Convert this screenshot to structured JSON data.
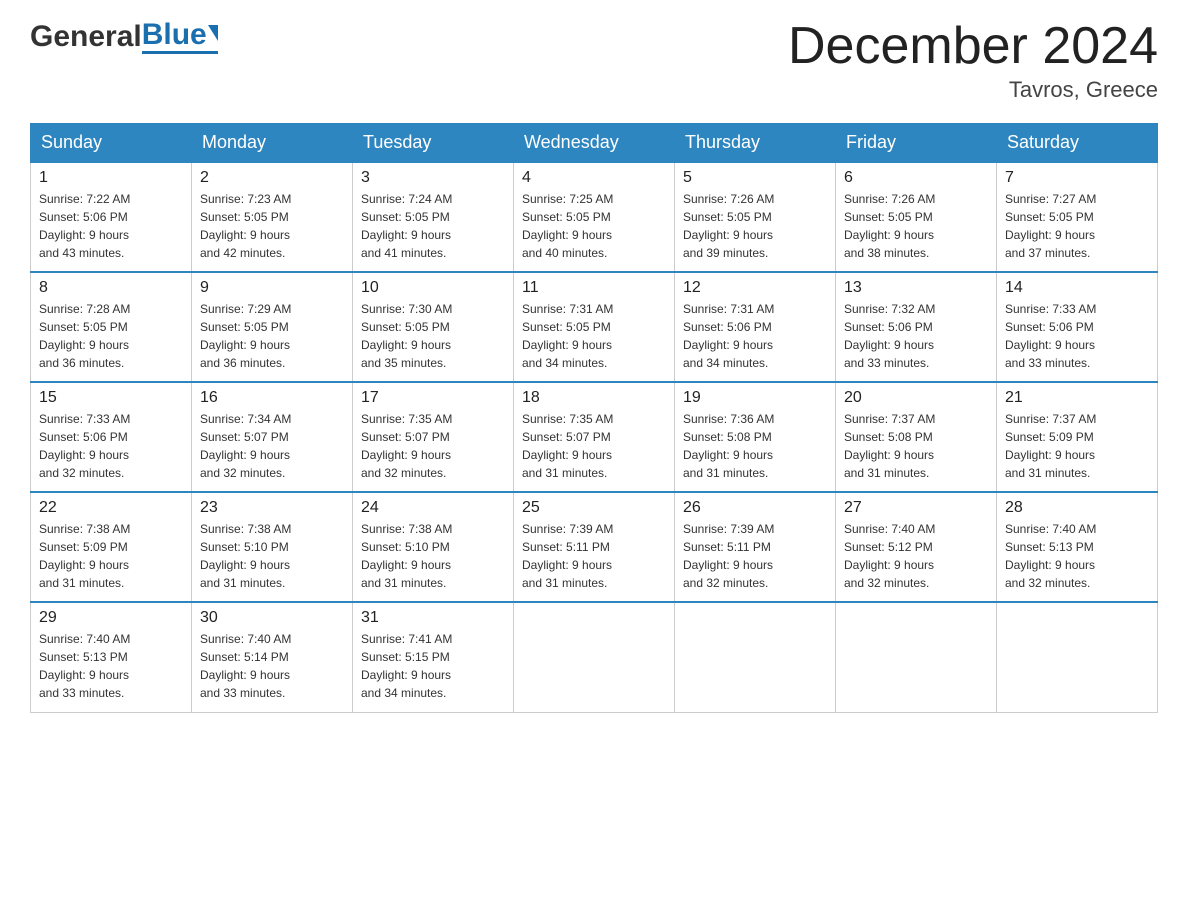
{
  "header": {
    "logo": {
      "general_text": "General",
      "blue_text": "Blue"
    },
    "title": "December 2024",
    "location": "Tavros, Greece"
  },
  "days_of_week": [
    "Sunday",
    "Monday",
    "Tuesday",
    "Wednesday",
    "Thursday",
    "Friday",
    "Saturday"
  ],
  "weeks": [
    [
      {
        "day": "1",
        "sunrise": "7:22 AM",
        "sunset": "5:06 PM",
        "daylight": "9 hours and 43 minutes."
      },
      {
        "day": "2",
        "sunrise": "7:23 AM",
        "sunset": "5:05 PM",
        "daylight": "9 hours and 42 minutes."
      },
      {
        "day": "3",
        "sunrise": "7:24 AM",
        "sunset": "5:05 PM",
        "daylight": "9 hours and 41 minutes."
      },
      {
        "day": "4",
        "sunrise": "7:25 AM",
        "sunset": "5:05 PM",
        "daylight": "9 hours and 40 minutes."
      },
      {
        "day": "5",
        "sunrise": "7:26 AM",
        "sunset": "5:05 PM",
        "daylight": "9 hours and 39 minutes."
      },
      {
        "day": "6",
        "sunrise": "7:26 AM",
        "sunset": "5:05 PM",
        "daylight": "9 hours and 38 minutes."
      },
      {
        "day": "7",
        "sunrise": "7:27 AM",
        "sunset": "5:05 PM",
        "daylight": "9 hours and 37 minutes."
      }
    ],
    [
      {
        "day": "8",
        "sunrise": "7:28 AM",
        "sunset": "5:05 PM",
        "daylight": "9 hours and 36 minutes."
      },
      {
        "day": "9",
        "sunrise": "7:29 AM",
        "sunset": "5:05 PM",
        "daylight": "9 hours and 36 minutes."
      },
      {
        "day": "10",
        "sunrise": "7:30 AM",
        "sunset": "5:05 PM",
        "daylight": "9 hours and 35 minutes."
      },
      {
        "day": "11",
        "sunrise": "7:31 AM",
        "sunset": "5:05 PM",
        "daylight": "9 hours and 34 minutes."
      },
      {
        "day": "12",
        "sunrise": "7:31 AM",
        "sunset": "5:06 PM",
        "daylight": "9 hours and 34 minutes."
      },
      {
        "day": "13",
        "sunrise": "7:32 AM",
        "sunset": "5:06 PM",
        "daylight": "9 hours and 33 minutes."
      },
      {
        "day": "14",
        "sunrise": "7:33 AM",
        "sunset": "5:06 PM",
        "daylight": "9 hours and 33 minutes."
      }
    ],
    [
      {
        "day": "15",
        "sunrise": "7:33 AM",
        "sunset": "5:06 PM",
        "daylight": "9 hours and 32 minutes."
      },
      {
        "day": "16",
        "sunrise": "7:34 AM",
        "sunset": "5:07 PM",
        "daylight": "9 hours and 32 minutes."
      },
      {
        "day": "17",
        "sunrise": "7:35 AM",
        "sunset": "5:07 PM",
        "daylight": "9 hours and 32 minutes."
      },
      {
        "day": "18",
        "sunrise": "7:35 AM",
        "sunset": "5:07 PM",
        "daylight": "9 hours and 31 minutes."
      },
      {
        "day": "19",
        "sunrise": "7:36 AM",
        "sunset": "5:08 PM",
        "daylight": "9 hours and 31 minutes."
      },
      {
        "day": "20",
        "sunrise": "7:37 AM",
        "sunset": "5:08 PM",
        "daylight": "9 hours and 31 minutes."
      },
      {
        "day": "21",
        "sunrise": "7:37 AM",
        "sunset": "5:09 PM",
        "daylight": "9 hours and 31 minutes."
      }
    ],
    [
      {
        "day": "22",
        "sunrise": "7:38 AM",
        "sunset": "5:09 PM",
        "daylight": "9 hours and 31 minutes."
      },
      {
        "day": "23",
        "sunrise": "7:38 AM",
        "sunset": "5:10 PM",
        "daylight": "9 hours and 31 minutes."
      },
      {
        "day": "24",
        "sunrise": "7:38 AM",
        "sunset": "5:10 PM",
        "daylight": "9 hours and 31 minutes."
      },
      {
        "day": "25",
        "sunrise": "7:39 AM",
        "sunset": "5:11 PM",
        "daylight": "9 hours and 31 minutes."
      },
      {
        "day": "26",
        "sunrise": "7:39 AM",
        "sunset": "5:11 PM",
        "daylight": "9 hours and 32 minutes."
      },
      {
        "day": "27",
        "sunrise": "7:40 AM",
        "sunset": "5:12 PM",
        "daylight": "9 hours and 32 minutes."
      },
      {
        "day": "28",
        "sunrise": "7:40 AM",
        "sunset": "5:13 PM",
        "daylight": "9 hours and 32 minutes."
      }
    ],
    [
      {
        "day": "29",
        "sunrise": "7:40 AM",
        "sunset": "5:13 PM",
        "daylight": "9 hours and 33 minutes."
      },
      {
        "day": "30",
        "sunrise": "7:40 AM",
        "sunset": "5:14 PM",
        "daylight": "9 hours and 33 minutes."
      },
      {
        "day": "31",
        "sunrise": "7:41 AM",
        "sunset": "5:15 PM",
        "daylight": "9 hours and 34 minutes."
      },
      null,
      null,
      null,
      null
    ]
  ],
  "labels": {
    "sunrise": "Sunrise:",
    "sunset": "Sunset:",
    "daylight": "Daylight:"
  },
  "colors": {
    "header_bg": "#2e86c1",
    "border_top": "#2e86c1"
  }
}
